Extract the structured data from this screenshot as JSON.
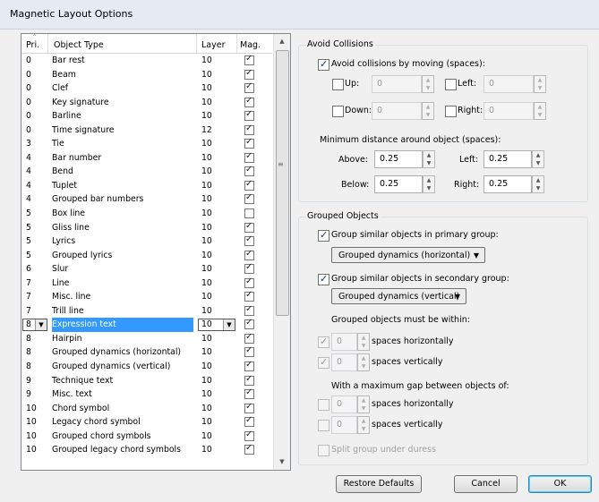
{
  "window": {
    "title": "Magnetic Layout Options"
  },
  "table": {
    "headers": {
      "priority": "Pri.",
      "type": "Object Type",
      "layer": "Layer",
      "mag": "Mag."
    },
    "rows": [
      {
        "pri": "0",
        "type": "Bar rest",
        "layer": "10",
        "mag": true
      },
      {
        "pri": "0",
        "type": "Beam",
        "layer": "10",
        "mag": true
      },
      {
        "pri": "0",
        "type": "Clef",
        "layer": "10",
        "mag": true
      },
      {
        "pri": "0",
        "type": "Key signature",
        "layer": "10",
        "mag": true
      },
      {
        "pri": "0",
        "type": "Barline",
        "layer": "10",
        "mag": true
      },
      {
        "pri": "0",
        "type": "Time signature",
        "layer": "12",
        "mag": true
      },
      {
        "pri": "3",
        "type": "Tie",
        "layer": "10",
        "mag": true
      },
      {
        "pri": "4",
        "type": "Bar number",
        "layer": "10",
        "mag": true
      },
      {
        "pri": "4",
        "type": "Bend",
        "layer": "10",
        "mag": true
      },
      {
        "pri": "4",
        "type": "Tuplet",
        "layer": "10",
        "mag": true
      },
      {
        "pri": "4",
        "type": "Grouped bar numbers",
        "layer": "10",
        "mag": true
      },
      {
        "pri": "5",
        "type": "Box line",
        "layer": "10",
        "mag": false
      },
      {
        "pri": "5",
        "type": "Gliss line",
        "layer": "10",
        "mag": true
      },
      {
        "pri": "5",
        "type": "Lyrics",
        "layer": "10",
        "mag": true
      },
      {
        "pri": "5",
        "type": "Grouped lyrics",
        "layer": "10",
        "mag": true
      },
      {
        "pri": "6",
        "type": "Slur",
        "layer": "10",
        "mag": true
      },
      {
        "pri": "7",
        "type": "Line",
        "layer": "10",
        "mag": true
      },
      {
        "pri": "7",
        "type": "Misc. line",
        "layer": "10",
        "mag": true
      },
      {
        "pri": "7",
        "type": "Trill line",
        "layer": "10",
        "mag": true
      },
      {
        "pri": "8",
        "type": "Expression text",
        "layer": "10",
        "mag": true,
        "selected": true
      },
      {
        "pri": "8",
        "type": "Hairpin",
        "layer": "10",
        "mag": true
      },
      {
        "pri": "8",
        "type": "Grouped dynamics (horizontal)",
        "layer": "10",
        "mag": true
      },
      {
        "pri": "8",
        "type": "Grouped dynamics (vertical)",
        "layer": "10",
        "mag": true
      },
      {
        "pri": "9",
        "type": "Technique text",
        "layer": "10",
        "mag": true
      },
      {
        "pri": "9",
        "type": "Misc. text",
        "layer": "10",
        "mag": true
      },
      {
        "pri": "10",
        "type": "Chord symbol",
        "layer": "10",
        "mag": true
      },
      {
        "pri": "10",
        "type": "Legacy chord symbol",
        "layer": "10",
        "mag": true
      },
      {
        "pri": "10",
        "type": "Grouped chord symbols",
        "layer": "10",
        "mag": true
      },
      {
        "pri": "10",
        "type": "Grouped legacy chord symbols",
        "layer": "10",
        "mag": true
      }
    ]
  },
  "avoid": {
    "title": "Avoid Collisions",
    "enable_label": "Avoid collisions by moving (spaces):",
    "enabled": true,
    "up": {
      "label": "Up:",
      "value": "0",
      "checked": false
    },
    "left": {
      "label": "Left:",
      "value": "0",
      "checked": false
    },
    "down": {
      "label": "Down:",
      "value": "0",
      "checked": false
    },
    "right": {
      "label": "Right:",
      "value": "0",
      "checked": false
    },
    "min_label": "Minimum distance around object (spaces):",
    "above": {
      "label": "Above:",
      "value": "0.25"
    },
    "left2": {
      "label": "Left:",
      "value": "0.25"
    },
    "below": {
      "label": "Below:",
      "value": "0.25"
    },
    "right2": {
      "label": "Right:",
      "value": "0.25"
    }
  },
  "grouped": {
    "title": "Grouped Objects",
    "primary_label": "Group similar objects in primary group:",
    "primary_checked": true,
    "primary_select": "Grouped dynamics (horizontal)",
    "secondary_label": "Group similar objects in secondary group:",
    "secondary_checked": true,
    "secondary_select": "Grouped dynamics (vertical)",
    "within_label": "Grouped objects must be within:",
    "within_h": {
      "value": "0",
      "label": "spaces horizontally",
      "checked": true
    },
    "within_v": {
      "value": "0",
      "label": "spaces vertically",
      "checked": true
    },
    "gap_label": "With a maximum gap between objects of:",
    "gap_h": {
      "value": "0",
      "label": "spaces horizontally",
      "checked": false
    },
    "gap_v": {
      "value": "0",
      "label": "spaces vertically",
      "checked": false
    },
    "split_label": "Split group under duress",
    "split_checked": false
  },
  "buttons": {
    "restore": "Restore Defaults",
    "cancel": "Cancel",
    "ok": "OK"
  }
}
